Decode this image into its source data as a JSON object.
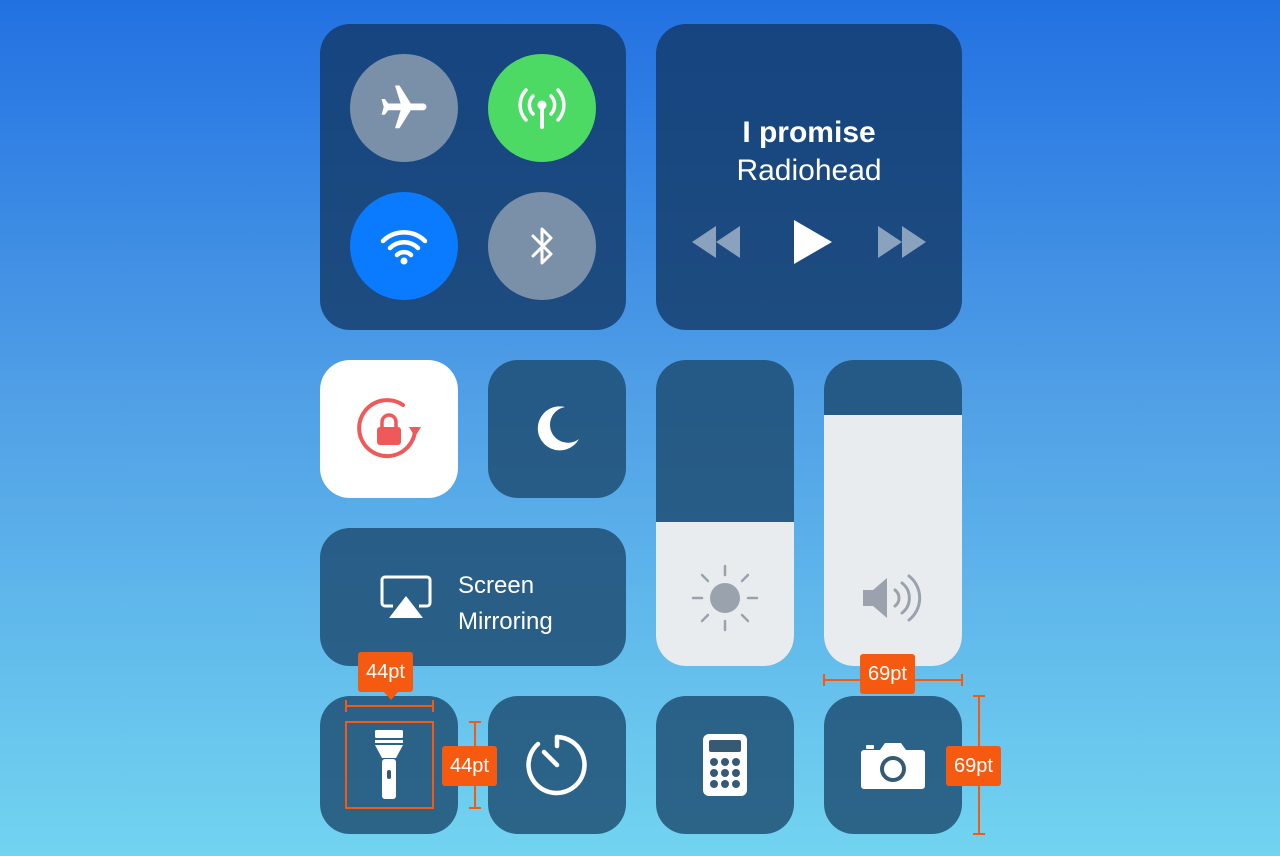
{
  "connectivity": {
    "airplane": {
      "icon": "airplane-icon",
      "state": "off",
      "color": "#7a8fa8"
    },
    "cellular": {
      "icon": "cellular-antenna-icon",
      "state": "on",
      "color": "#4cd964"
    },
    "wifi": {
      "icon": "wifi-icon",
      "state": "on",
      "color": "#0a7aff"
    },
    "bluetooth": {
      "icon": "bluetooth-icon",
      "state": "off",
      "color": "#7a8fa8"
    }
  },
  "media": {
    "title": "I promise",
    "artist": "Radiohead",
    "controls": [
      "rewind-icon",
      "play-icon",
      "fast-forward-icon"
    ]
  },
  "rotation_lock": {
    "icon": "rotation-lock-icon",
    "state": "on",
    "accent": "#f0595a"
  },
  "do_not_disturb": {
    "icon": "moon-icon",
    "state": "off"
  },
  "brightness": {
    "icon": "sun-icon",
    "level": 0.47
  },
  "volume": {
    "icon": "speaker-icon",
    "level": 0.82
  },
  "screen_mirroring": {
    "icon": "airplay-icon",
    "label_line1": "Screen",
    "label_line2": "Mirroring"
  },
  "shortcuts": [
    {
      "icon": "flashlight-icon"
    },
    {
      "icon": "timer-icon"
    },
    {
      "icon": "calculator-icon"
    },
    {
      "icon": "camera-icon"
    }
  ],
  "annotations": {
    "small_width": "44pt",
    "small_height": "44pt",
    "large_width": "69pt",
    "large_height": "69pt",
    "accent": "#f55a10"
  }
}
